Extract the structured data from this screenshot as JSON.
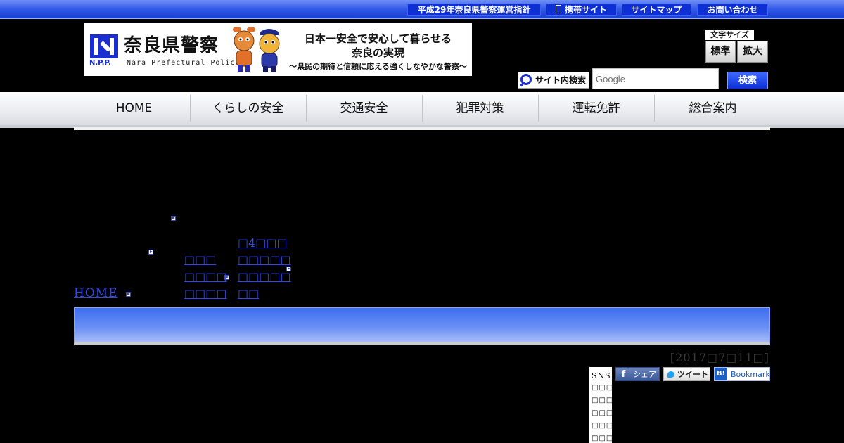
{
  "topbar": {
    "links": [
      {
        "label": "平成29年奈良県警察運営指針"
      },
      {
        "label": "携帯サイト"
      },
      {
        "label": "サイトマップ"
      },
      {
        "label": "お問い合わせ"
      }
    ]
  },
  "banner": {
    "logo_mark": "N.P.P.",
    "name": "奈良県警察",
    "name_en": "Nara Prefectural Police",
    "slogan_line1": "日本一安全で安心して暮らせる",
    "slogan_line2": "奈良の実現",
    "slogan_line3": "～県民の期待と信頼に応える強くしなやかな警察～"
  },
  "font_size": {
    "label": "文字サイズ",
    "standard": "標準",
    "large": "拡大"
  },
  "search": {
    "label": "サイト内検索",
    "placeholder": "Google",
    "button": "検索"
  },
  "nav": {
    "items": [
      {
        "label": "HOME"
      },
      {
        "label": "くらしの安全"
      },
      {
        "label": "交通安全"
      },
      {
        "label": "犯罪対策"
      },
      {
        "label": "運転免許"
      },
      {
        "label": "総合案内"
      }
    ]
  },
  "breadcrumb": {
    "home": "HOME",
    "item2_lines": [
      "□□□",
      "□□□□",
      "□□□□"
    ],
    "item3_lines": [
      "□4□□□",
      "□□□□□",
      "□□□□□",
      "□□"
    ]
  },
  "date": "[2017□7□11□]",
  "sns": {
    "title": "SNS",
    "rows": [
      "□□□",
      "□□□",
      "□□□",
      "□□□",
      "□□□"
    ],
    "facebook": "シェア",
    "twitter": "ツイート",
    "hatena_icon": "B!",
    "hatena": "Bookmark"
  },
  "colors": {
    "accent_blue": "#1b2fd0",
    "link_blue": "#2f48e8",
    "background": "#000000"
  }
}
